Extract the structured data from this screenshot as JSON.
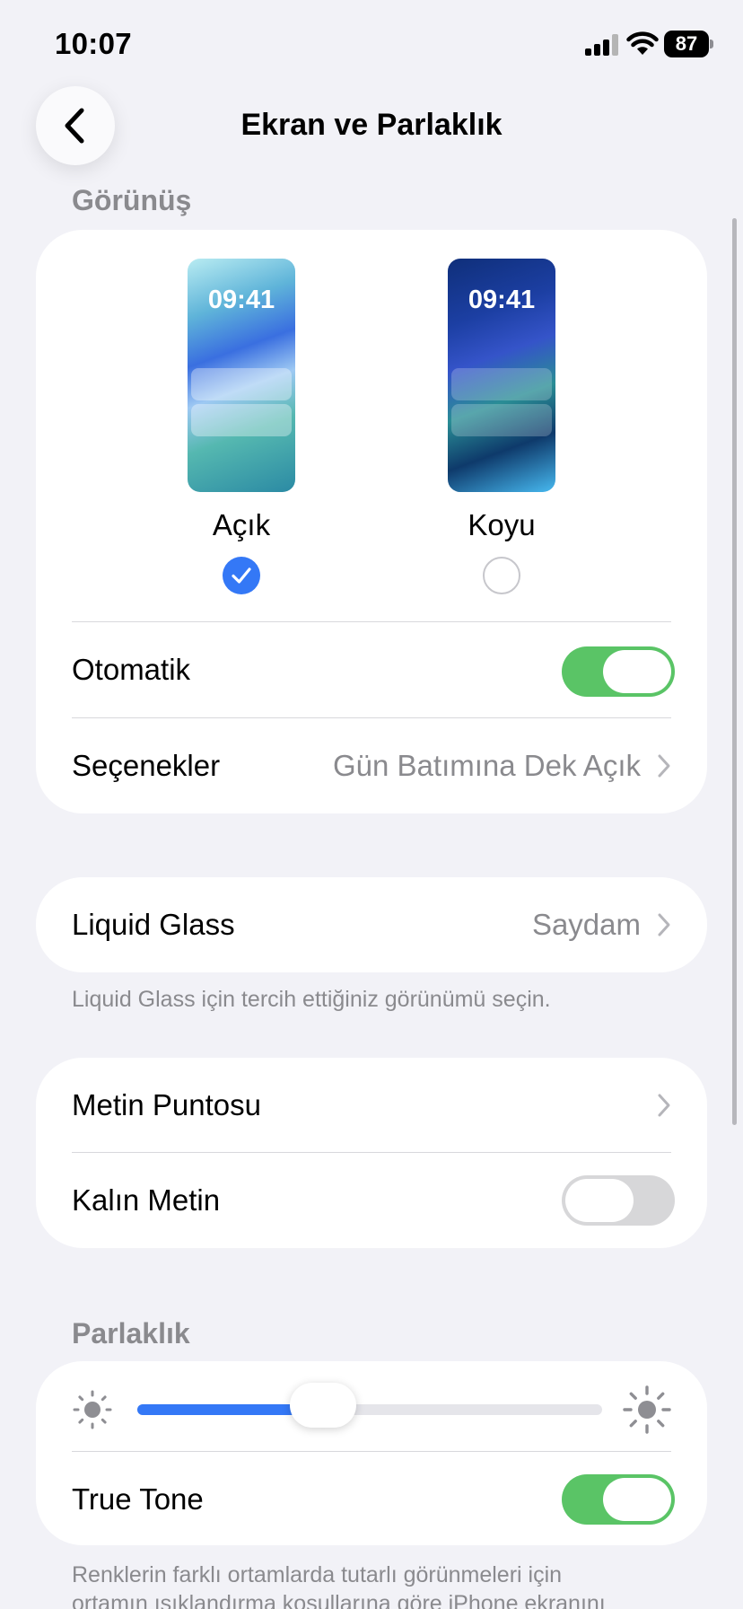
{
  "status_bar": {
    "time": "10:07",
    "battery": "87"
  },
  "nav": {
    "title": "Ekran ve Parlaklık"
  },
  "appearance": {
    "header": "Görünüş",
    "light": {
      "time": "09:41",
      "label": "Açık",
      "selected": true
    },
    "dark": {
      "time": "09:41",
      "label": "Koyu",
      "selected": false
    },
    "automatic": {
      "label": "Otomatik",
      "on": true
    },
    "options": {
      "label": "Seçenekler",
      "value": "Gün Batımına Dek Açık"
    }
  },
  "liquid_glass": {
    "label": "Liquid Glass",
    "value": "Saydam",
    "footnote": "Liquid Glass için tercih ettiğiniz görünümü seçin."
  },
  "text": {
    "size": {
      "label": "Metin Puntosu"
    },
    "bold": {
      "label": "Kalın Metin",
      "on": false
    }
  },
  "brightness": {
    "header": "Parlaklık",
    "level": 0.4,
    "true_tone": {
      "label": "True Tone",
      "on": true
    },
    "footnote_line1": "Renklerin farklı ortamlarda tutarlı görünmeleri için",
    "footnote_line2": "ortamın ışıklandırma koşullarına göre iPhone ekranını"
  },
  "colors": {
    "accent": "#3478f6",
    "toggle_on": "#5ac466",
    "toggle_off": "#d7d7d9",
    "background": "#f2f2f7",
    "secondary_text": "#8a8a8e"
  }
}
